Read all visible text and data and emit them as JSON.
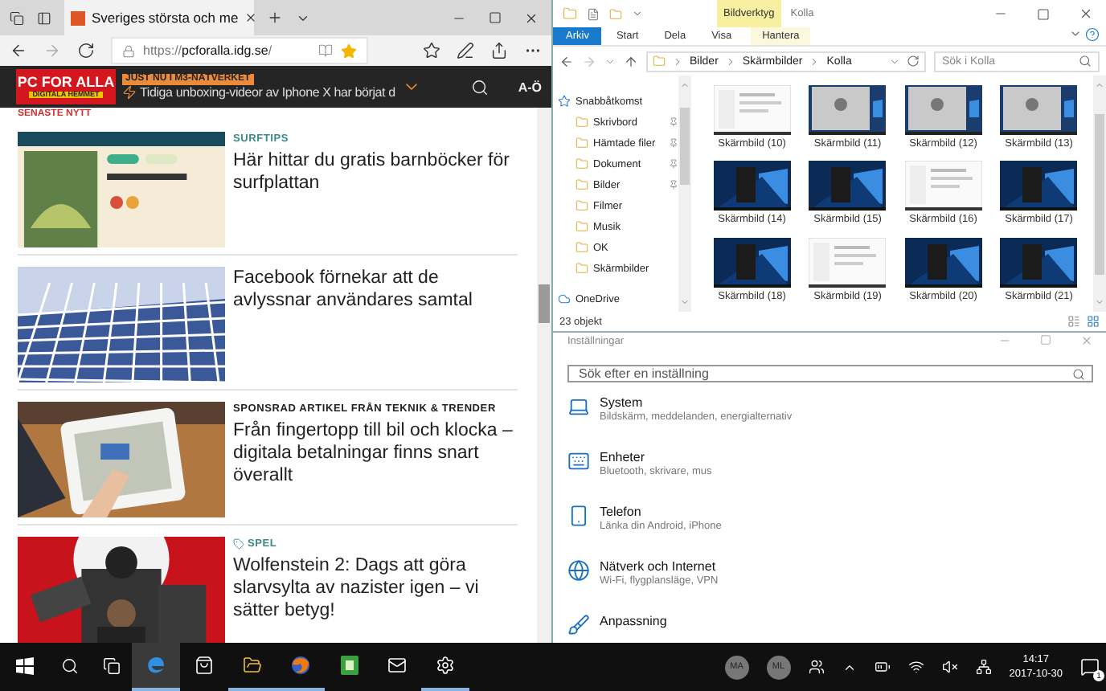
{
  "browser": {
    "tabs": [
      {
        "title": "Sveriges största och me",
        "selected": true
      }
    ],
    "address": {
      "scheme": "https://",
      "domain": "pcforalla.idg.se",
      "path": "/"
    },
    "favorite": true,
    "site": {
      "logo_line_1": "PC FOR ALLA",
      "logo_line_2": "DIGITALA HEMMET",
      "ticker_label": "JUST NU I M3-NÄTVERKET",
      "ticker_text": "Tidiga unboxing-videor av Iphone X har börjat d",
      "az_label": "A-Ö"
    },
    "section_heading": "SENASTE NYTT",
    "articles": [
      {
        "category": {
          "kind": "topic",
          "label": "SURFTIPS"
        },
        "title": "Här hittar du gratis barnböcker för surfplattan"
      },
      {
        "title": "Facebook förnekar att de avlyssnar användares samtal"
      },
      {
        "category": {
          "kind": "sponsored",
          "label": "SPONSRAD ARTIKEL FRÅN TEKNIK & TRENDER"
        },
        "title": "Från fingertopp till bil och klocka – digitala betalningar finns snart överallt"
      },
      {
        "category": {
          "kind": "tag",
          "label": "SPEL"
        },
        "title": "Wolfenstein 2: Dags att göra slarvsylta av nazister igen – vi sätter betyg!"
      }
    ]
  },
  "explorer": {
    "title": "Kolla",
    "context_label": "Bildverktyg",
    "ribbon_tabs": [
      {
        "label": "Arkiv",
        "kind": "file"
      },
      {
        "label": "Start",
        "kind": "normal"
      },
      {
        "label": "Dela",
        "kind": "normal"
      },
      {
        "label": "Visa",
        "kind": "normal"
      },
      {
        "label": "Hantera",
        "kind": "context"
      }
    ],
    "breadcrumbs": [
      "Bilder",
      "Skärmbilder",
      "Kolla"
    ],
    "search": {
      "placeholder": "Sök i Kolla"
    },
    "nav": [
      {
        "label": "Snabbåtkomst",
        "children": [
          {
            "label": "Skrivbord",
            "pinned": true
          },
          {
            "label": "Hämtade filer",
            "pinned": true
          },
          {
            "label": "Dokument",
            "pinned": true
          },
          {
            "label": "Bilder",
            "pinned": true
          },
          {
            "label": "Filmer",
            "pinned": false
          },
          {
            "label": "Musik",
            "pinned": false
          },
          {
            "label": "OK",
            "pinned": false
          },
          {
            "label": "Skärmbilder",
            "pinned": false
          }
        ]
      },
      {
        "label": "OneDrive"
      }
    ],
    "files": [
      "Skärmbild (10)",
      "Skärmbild (11)",
      "Skärmbild (12)",
      "Skärmbild (13)",
      "Skärmbild (14)",
      "Skärmbild (15)",
      "Skärmbild (16)",
      "Skärmbild (17)",
      "Skärmbild (18)",
      "Skärmbild (19)",
      "Skärmbild (20)",
      "Skärmbild (21)"
    ],
    "status": "23 objekt"
  },
  "settings": {
    "title": "Inställningar",
    "search": {
      "placeholder": "Sök efter en inställning"
    },
    "categories": [
      {
        "title": "System",
        "subtitle": "Bildskärm, meddelanden, energialternativ"
      },
      {
        "title": "Enheter",
        "subtitle": "Bluetooth, skrivare, mus"
      },
      {
        "title": "Telefon",
        "subtitle": "Länka din Android, iPhone"
      },
      {
        "title": "Nätverk och Internet",
        "subtitle": "Wi-Fi, flygplansläge, VPN"
      },
      {
        "title": "Anpassning"
      }
    ]
  },
  "taskbar": {
    "apps": [
      {
        "active": true,
        "running": true
      },
      {
        "active": false,
        "running": false
      },
      {
        "active": false,
        "running": true
      },
      {
        "active": false,
        "running": true
      },
      {
        "active": false,
        "running": false
      },
      {
        "active": false,
        "running": false
      },
      {
        "active": false,
        "running": true
      }
    ],
    "people": [
      "MA",
      "ML"
    ],
    "time": "14:17",
    "date": "2017-10-30",
    "notifications": "1"
  }
}
